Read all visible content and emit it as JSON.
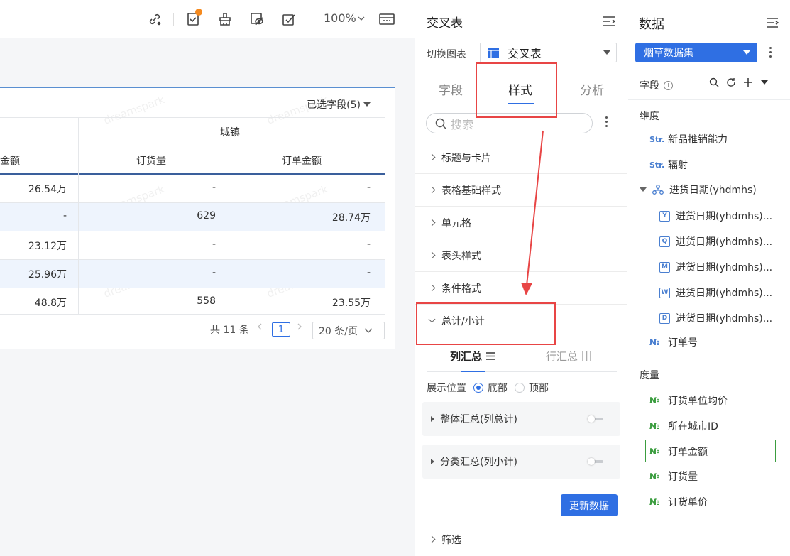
{
  "toolbar": {
    "zoom": "100%",
    "icons": [
      "link-icon",
      "report-icon",
      "broom-icon",
      "hide-icon",
      "checklist-icon",
      "layout-icon"
    ]
  },
  "widget": {
    "selected_fields": "已选字段(5)",
    "watermark": "dreamspark",
    "group_header": "城镇",
    "columns": [
      "金额",
      "订货量",
      "订单金额"
    ],
    "rows": [
      [
        "26.54万",
        "-",
        "-"
      ],
      [
        "-",
        "629",
        "28.74万"
      ],
      [
        "23.12万",
        "-",
        "-"
      ],
      [
        "25.96万",
        "-",
        "-"
      ],
      [
        "48.8万",
        "558",
        "23.55万"
      ]
    ],
    "pager": {
      "total": "共 11 条",
      "page": "1",
      "page_size": "20 条/页"
    }
  },
  "style_panel": {
    "title": "交叉表",
    "switch_label": "切换图表",
    "chart_type": "交叉表",
    "tabs": [
      "字段",
      "样式",
      "分析"
    ],
    "active_tab": "样式",
    "search_placeholder": "搜索",
    "sections": [
      "标题与卡片",
      "表格基础样式",
      "单元格",
      "表头样式",
      "条件格式"
    ],
    "expanded_section": "总计/小计",
    "subtabs": [
      "列汇总",
      "行汇总"
    ],
    "position_label": "展示位置",
    "position_options": [
      "底部",
      "顶部"
    ],
    "position_selected": "底部",
    "totals": [
      {
        "label": "整体汇总(列总计)",
        "enabled": false
      },
      {
        "label": "分类汇总(列小计)",
        "enabled": false
      }
    ],
    "update_button": "更新数据",
    "filter_section": "筛选"
  },
  "data_panel": {
    "title": "数据",
    "dataset": "烟草数据集",
    "field_label": "字段",
    "dimension_label": "维度",
    "dimensions": [
      {
        "icon": "Str.",
        "label": "新品推销能力"
      },
      {
        "icon": "Str.",
        "label": "辐射"
      }
    ],
    "date_group": "进货日期(yhdmhs)",
    "date_children": [
      {
        "icon": "Y",
        "label": "进货日期(yhdmhs)..."
      },
      {
        "icon": "Q",
        "label": "进货日期(yhdmhs)..."
      },
      {
        "icon": "M",
        "label": "进货日期(yhdmhs)..."
      },
      {
        "icon": "W",
        "label": "进货日期(yhdmhs)..."
      },
      {
        "icon": "D",
        "label": "进货日期(yhdmhs)..."
      }
    ],
    "order_no": {
      "icon": "№",
      "label": "订单号"
    },
    "measure_label": "度量",
    "measures": [
      {
        "icon": "№",
        "label": "订货单位均价"
      },
      {
        "icon": "№",
        "label": "所在城市ID"
      },
      {
        "icon": "№",
        "label": "订单金额"
      },
      {
        "icon": "№",
        "label": "订货量"
      },
      {
        "icon": "№",
        "label": "订货单价"
      }
    ],
    "highlight_color": "#3b9d3f"
  },
  "colors": {
    "accent": "#2f6fe3",
    "annotation_red": "#e84545",
    "badge_orange": "#f58a1f"
  }
}
